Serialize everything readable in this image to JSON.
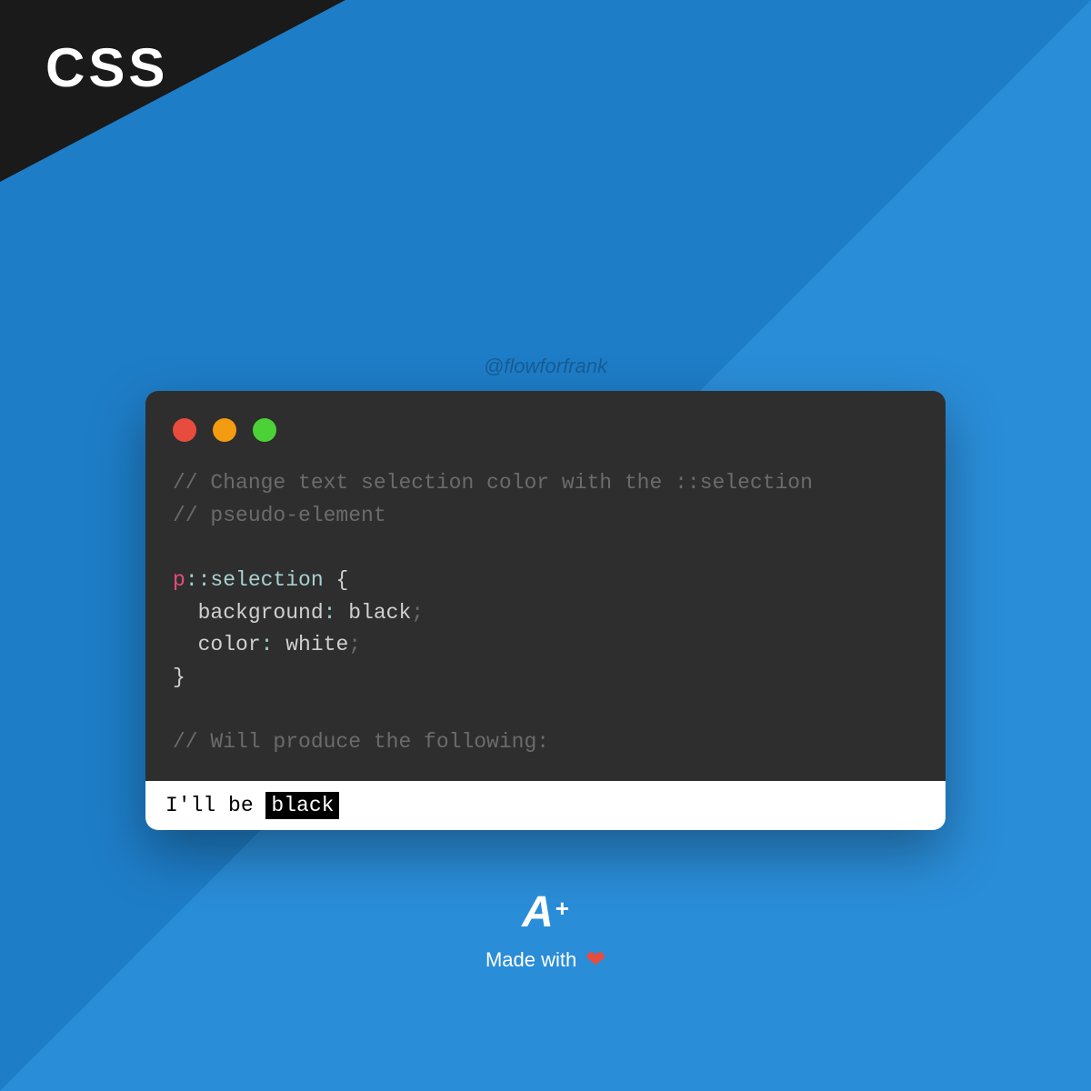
{
  "corner": {
    "label": "CSS"
  },
  "watermark": "@flowforfrank",
  "code": {
    "comment1": "// Change text selection color with the ::selection",
    "comment2": "// pseudo-element",
    "selector_tag": "p",
    "selector_pseudo": "::selection",
    "brace_open": " {",
    "prop1": "background",
    "val1": "black",
    "prop2": "color",
    "val2": "white",
    "brace_close": "}",
    "comment3": "// Will produce the following:"
  },
  "output": {
    "prefix": "I'll be ",
    "selected": "black"
  },
  "footer": {
    "logo_a": "A",
    "logo_plus": "+",
    "made_with": "Made with",
    "heart": "❤"
  }
}
